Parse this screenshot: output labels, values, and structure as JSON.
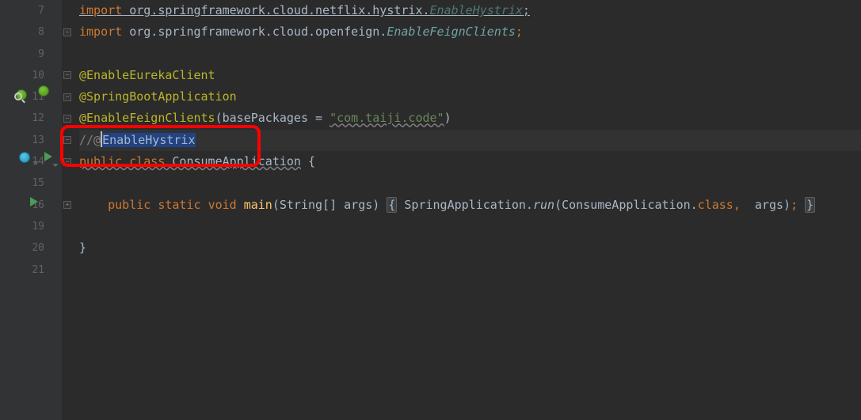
{
  "gutter": {
    "line_numbers": [
      "7",
      "8",
      "9",
      "10",
      "11",
      "12",
      "13",
      "14",
      "15",
      "16",
      "19",
      "20",
      "21"
    ]
  },
  "code": {
    "l7_kw": "import",
    "l7_pkg": " org.springframework.cloud.netflix.hystrix.",
    "l7_cls": "EnableHystrix",
    "l7_semi": ";",
    "l8_kw": "import",
    "l8_pkg": " org.springframework.cloud.openfeign.",
    "l8_cls": "EnableFeignClients",
    "l8_semi": ";",
    "l10_anno": "@EnableEurekaClient",
    "l11_anno": "@SpringBootApplication",
    "l12_anno": "@EnableFeignClients",
    "l12_open": "(",
    "l12_param": "basePackages",
    "l12_eq": " = ",
    "l12_str": "\"com.taiji.code\"",
    "l12_close": ")",
    "l13_cmt_pre": "//@",
    "l13_cmt_sel": "EnableHystrix",
    "l14_pub": "public ",
    "l14_class": "class ",
    "l14_name": "ConsumeApplication",
    "l14_brace": " {",
    "l16_indent": "    ",
    "l16_pub": "public ",
    "l16_static": "static ",
    "l16_void": "void ",
    "l16_main": "main",
    "l16_params": "(String[] args)",
    "l16_sp": " ",
    "l16_ob": "{",
    "l16_sp2": " ",
    "l16_app": "SpringApplication.",
    "l16_run": "run",
    "l16_args_open": "(",
    "l16_argcls": "ConsumeApplication.",
    "l16_classkw": "class",
    "l16_comma": ",",
    "l16_sp3": "  args)",
    "l16_semi": ";",
    "l16_sp4": " ",
    "l16_cb": "}",
    "l20_brace": "}"
  },
  "annotations": {
    "highlight_box_label": "commented-annotation-highlight"
  }
}
